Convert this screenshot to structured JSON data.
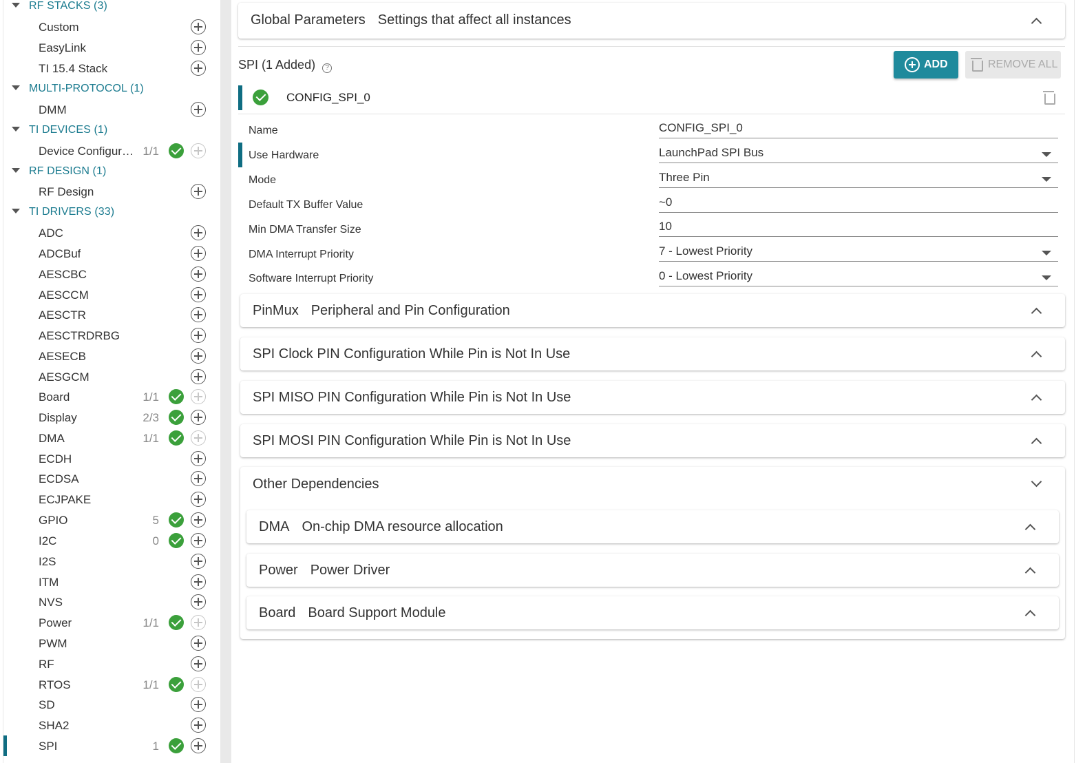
{
  "sidebar": {
    "categories": {
      "rf_stacks": "RF STACKS (3)",
      "multi_protocol": "MULTI-PROTOCOL (1)",
      "ti_devices": "TI DEVICES (1)",
      "rf_design": "RF DESIGN (1)",
      "ti_drivers": "TI DRIVERS (33)"
    },
    "modules": [
      {
        "label": "Custom",
        "count": ""
      },
      {
        "label": "EasyLink",
        "count": ""
      },
      {
        "label": "TI 15.4 Stack",
        "count": ""
      },
      {
        "label": "DMM",
        "count": ""
      },
      {
        "label": "Device Configuration",
        "count": "1/1"
      },
      {
        "label": "RF Design",
        "count": ""
      },
      {
        "label": "ADC",
        "count": ""
      },
      {
        "label": "ADCBuf",
        "count": ""
      },
      {
        "label": "AESCBC",
        "count": ""
      },
      {
        "label": "AESCCM",
        "count": ""
      },
      {
        "label": "AESCTR",
        "count": ""
      },
      {
        "label": "AESCTRDRBG",
        "count": ""
      },
      {
        "label": "AESECB",
        "count": ""
      },
      {
        "label": "AESGCM",
        "count": ""
      },
      {
        "label": "Board",
        "count": "1/1"
      },
      {
        "label": "Display",
        "count": "2/3"
      },
      {
        "label": "DMA",
        "count": "1/1"
      },
      {
        "label": "ECDH",
        "count": ""
      },
      {
        "label": "ECDSA",
        "count": ""
      },
      {
        "label": "ECJPAKE",
        "count": ""
      },
      {
        "label": "GPIO",
        "count": "5"
      },
      {
        "label": "I2C",
        "count": "0"
      },
      {
        "label": "I2S",
        "count": ""
      },
      {
        "label": "ITM",
        "count": ""
      },
      {
        "label": "NVS",
        "count": ""
      },
      {
        "label": "Power",
        "count": "1/1"
      },
      {
        "label": "PWM",
        "count": ""
      },
      {
        "label": "RF",
        "count": ""
      },
      {
        "label": "RTOS",
        "count": "1/1"
      },
      {
        "label": "SD",
        "count": ""
      },
      {
        "label": "SHA2",
        "count": ""
      },
      {
        "label": "SPI",
        "count": "1"
      }
    ]
  },
  "global": {
    "title": "Global Parameters",
    "subtitle": "Settings that affect all instances"
  },
  "spi": {
    "heading": "SPI (1 Added)",
    "help_icon": "?",
    "add_label": "ADD",
    "remove_label": "REMOVE ALL",
    "instance_name": "CONFIG_SPI_0"
  },
  "fields": [
    {
      "label": "Name",
      "value": "CONFIG_SPI_0"
    },
    {
      "label": "Use Hardware",
      "value": "LaunchPad SPI Bus"
    },
    {
      "label": "Mode",
      "value": "Three Pin"
    },
    {
      "label": "Default TX Buffer Value",
      "value": "~0"
    },
    {
      "label": "Min DMA Transfer Size",
      "value": "10"
    },
    {
      "label": "DMA Interrupt Priority",
      "value": "7 - Lowest Priority"
    },
    {
      "label": "Software Interrupt Priority",
      "value": "0 - Lowest Priority"
    }
  ],
  "sections": {
    "pinmux": {
      "title": "PinMux",
      "subtitle": "Peripheral and Pin Configuration"
    },
    "spi_clock": {
      "title": "SPI Clock PIN Configuration While Pin is Not In Use"
    },
    "spi_miso": {
      "title": "SPI MISO PIN Configuration While Pin is Not In Use"
    },
    "spi_mosi": {
      "title": "SPI MOSI PIN Configuration While Pin is Not In Use"
    },
    "other_deps": {
      "title": "Other Dependencies"
    },
    "dma": {
      "title": "DMA",
      "subtitle": "On-chip DMA resource allocation"
    },
    "power": {
      "title": "Power",
      "subtitle": "Power Driver"
    },
    "board": {
      "title": "Board",
      "subtitle": "Board Support Module"
    }
  },
  "colors": {
    "accent": "#1b7b8f",
    "check": "#3ba03b",
    "add_button": "#1f8a9c"
  }
}
